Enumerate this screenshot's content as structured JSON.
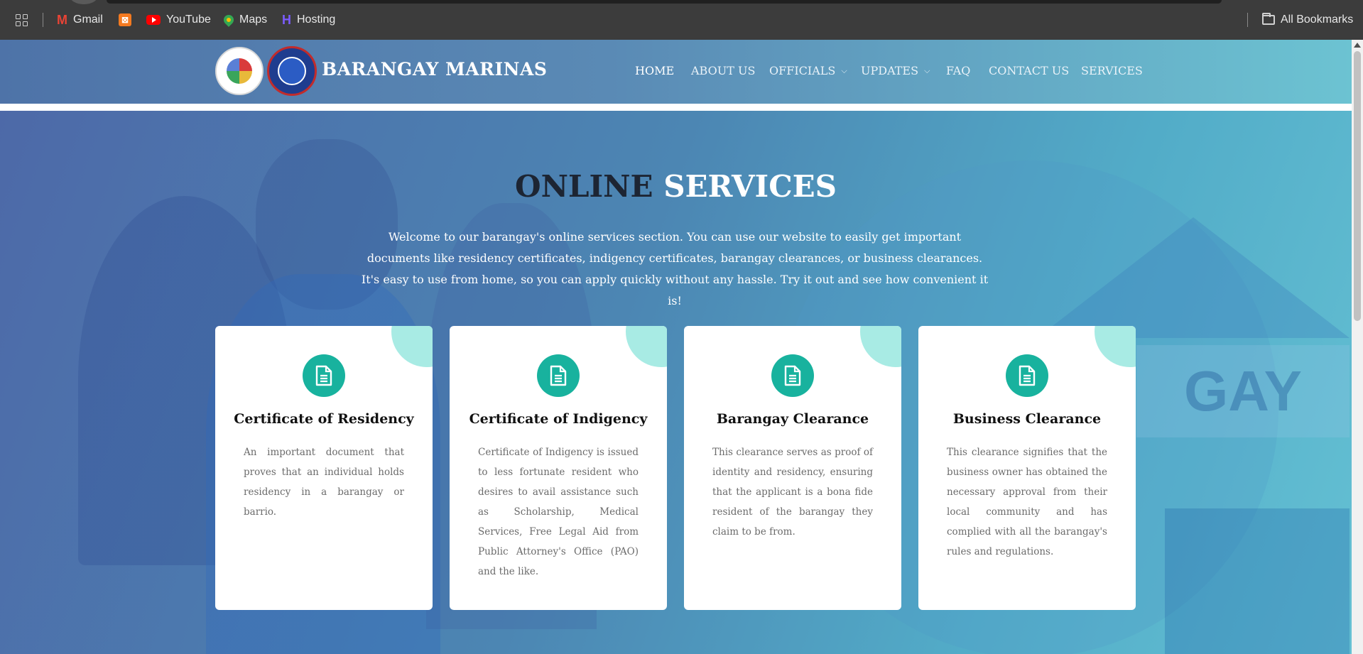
{
  "browser": {
    "bookmarks": [
      {
        "label": "Gmail",
        "icon": "gmail-icon"
      },
      {
        "label": "",
        "icon": "xampp-icon"
      },
      {
        "label": "YouTube",
        "icon": "youtube-icon"
      },
      {
        "label": "Maps",
        "icon": "maps-icon"
      },
      {
        "label": "Hosting",
        "icon": "hosting-icon"
      }
    ],
    "all_bookmarks": "All Bookmarks"
  },
  "header": {
    "brand": "BARANGAY MARINAS",
    "nav": [
      {
        "label": "HOME",
        "active": true
      },
      {
        "label": "ABOUT US"
      },
      {
        "label": "OFFICIALS",
        "dropdown": true
      },
      {
        "label": "UPDATES",
        "dropdown": true
      },
      {
        "label": "FAQ"
      },
      {
        "label": "CONTACT US"
      },
      {
        "label": "SERVICES"
      }
    ]
  },
  "hero": {
    "title_dark": "ONLINE",
    "title_light": "SERVICES",
    "intro": "Welcome to our barangay's online services section. You can use our website to easily get important documents like residency certificates, indigency certificates, barangay clearances, or business clearances. It's easy to use from home, so you can apply quickly without any hassle. Try it out and see how convenient it is!",
    "background_text": "GAY"
  },
  "services": [
    {
      "title": "Certificate of Residency",
      "description": "An important document that proves that an individual holds residency in a barangay or barrio."
    },
    {
      "title": "Certificate of Indigency",
      "description": "Certificate of Indigency is issued to less fortunate resident who desires to avail assistance such as Scholarship, Medical Services, Free Legal Aid from Public Attorney's Office (PAO) and the like."
    },
    {
      "title": "Barangay Clearance",
      "description": "This clearance serves as proof of identity and residency, ensuring that the applicant is a bona fide resident of the barangay they claim to be from."
    },
    {
      "title": "Business Clearance",
      "description": "This clearance signifies that the business owner has obtained the necessary approval from their local community and has complied with all the barangay's rules and regulations."
    }
  ],
  "colors": {
    "accent": "#18b29e",
    "accent_light": "#a8ebe4",
    "title_dark": "#1d2533"
  }
}
